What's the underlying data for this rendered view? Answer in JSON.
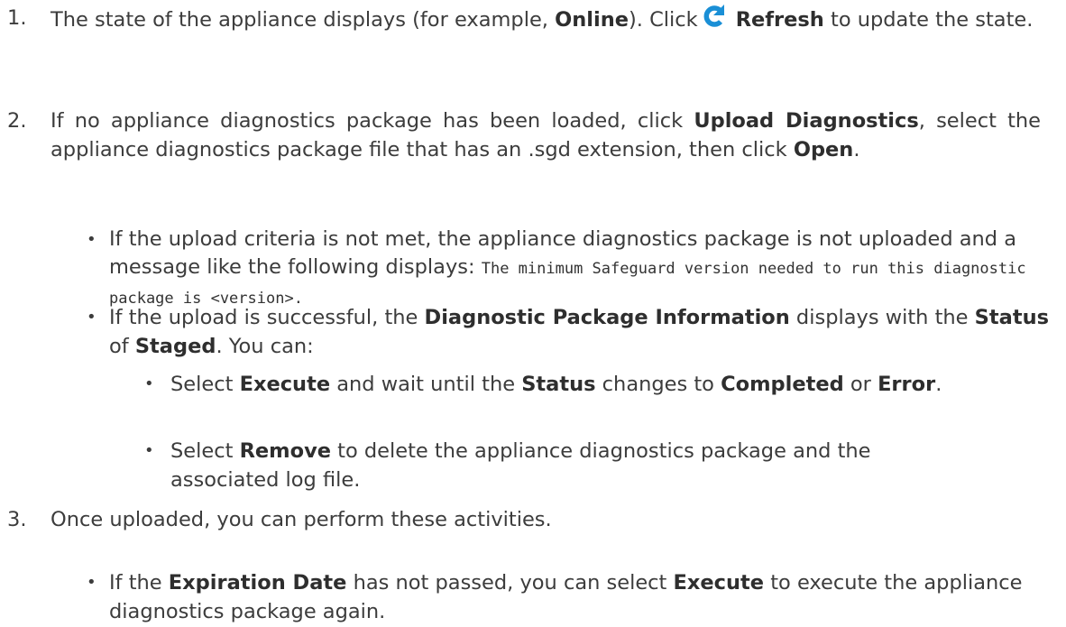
{
  "step1": {
    "number": "1.",
    "t1": "The state of the appliance displays (for example, ",
    "online": "Online",
    "t2": "). Click",
    "refresh": "Refresh",
    "t3": " to update the state."
  },
  "step2": {
    "number": "2.",
    "t1": "If no appliance diagnostics package has been loaded, click ",
    "upload": "Upload Diagnostics",
    "t2": ", select the appliance diagnostics package file that has an .sgd extension, then click ",
    "open": "Open",
    "t3": ".",
    "bullet1": {
      "t1": "If the upload criteria is not met, the appliance diagnostics package is not uploaded and a message like the following displays: ",
      "code": "The minimum Safeguard version needed to run this diagnostic package is <version>."
    },
    "bullet2": {
      "t1": "If the upload is successful, the ",
      "info": "Diagnostic Package Information",
      "t2": " displays with the ",
      "status": "Status",
      "t3": " of ",
      "staged": "Staged",
      "t4": ". You can:",
      "sub1": {
        "t1": "Select ",
        "execute": "Execute",
        "t2": " and wait until the ",
        "status": "Status",
        "t3": " changes to ",
        "completed": "Completed",
        "t4": " or ",
        "error": "Error",
        "t5": "."
      },
      "sub2": {
        "t1": "Select ",
        "remove": "Remove",
        "t2": " to delete the appliance diagnostics package and the associated log file."
      }
    }
  },
  "step3": {
    "number": "3.",
    "t1": "Once uploaded, you can perform these activities.",
    "bullet1": {
      "t1": "If the ",
      "expiration": "Expiration Date",
      "t2": " has not passed, you can select ",
      "execute": "Execute",
      "t3": " to execute the appliance diagnostics package again."
    }
  },
  "colors": {
    "text": "#3c3c3c",
    "refresh_icon": "#1a8fd6"
  }
}
